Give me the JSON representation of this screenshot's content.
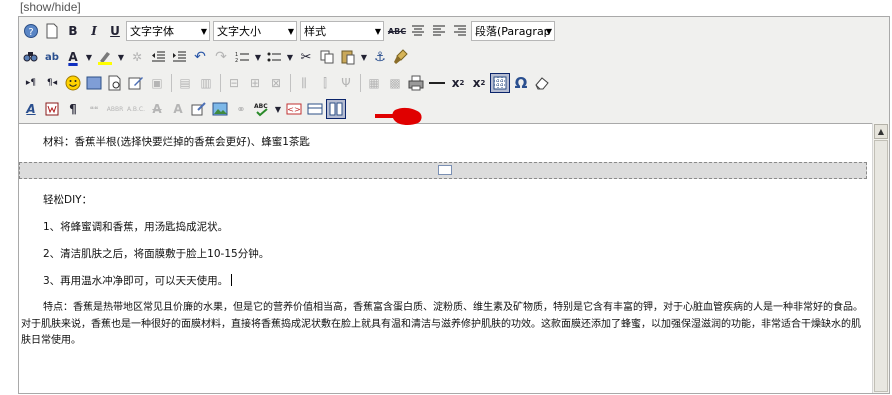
{
  "show_hide_link": "[show/hide]",
  "toolbar": {
    "font_family": "文字字体",
    "font_size": "文字大小",
    "style": "样式",
    "paragraph_format": "段落(Paragrap",
    "spell_label": "ABC",
    "abbr_label": "ABBR",
    "acronym_label": "A.B.C.",
    "omega": "Ω"
  },
  "content": {
    "line_materials": "材料：香蕉半根(选择快要烂掉的香蕉会更好)、蜂蜜1茶匙",
    "line_title": "轻松DIY：",
    "step1": "1、将蜂蜜调和香蕉，用汤匙捣成泥状。",
    "step2": "2、清洁肌肤之后，将面膜敷于脸上10-15分钟。",
    "step3": "3、再用温水冲净即可，可以天天使用。",
    "features": "特点：香蕉是热带地区常见且价廉的水果，但是它的营养价值相当高，香蕉富含蛋白质、淀粉质、维生素及矿物质，特别是它含有丰富的钾，对于心脏血管疾病的人是一种非常好的食品。对于肌肤来说，香蕉也是一种很好的面膜材料，直接将香蕉捣成泥状敷在脸上就具有温和清洁与滋养修护肌肤的功效。这款面膜还添加了蜂蜜，以加强保湿滋润的功能，非常适合干燥缺水的肌肤日常使用。"
  },
  "colors": {
    "toolbar_bg": "#f0f0ee",
    "pointer": "#e00000"
  }
}
